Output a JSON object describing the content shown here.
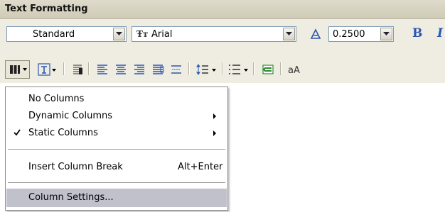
{
  "panel": {
    "title": "Text Formatting"
  },
  "row1": {
    "style_value": "Standard",
    "font_value": "Arial",
    "height_value": "0.2500",
    "bold_label": "B",
    "italic_label": "I"
  },
  "row2": {
    "case_label": "aA"
  },
  "menu": {
    "items": [
      {
        "label": "No Columns"
      },
      {
        "label": "Dynamic Columns"
      },
      {
        "label": "Static Columns"
      },
      {
        "label": "Insert Column Break",
        "shortcut": "Alt+Enter"
      },
      {
        "label": "Column Settings..."
      }
    ]
  },
  "colors": {
    "panel_bg": "#efede2",
    "title_bar": "#d6d2c0",
    "field_border": "#7f9db9",
    "highlight": "#c1c1cc",
    "accent_blue": "#2b56b0",
    "green_icon": "#2e8b2e"
  },
  "icons": [
    "columns-icon",
    "justify-icon",
    "paragraph-icon",
    "align-left-icon",
    "align-center-icon",
    "align-right-icon",
    "align-justify-icon",
    "distribute-icon",
    "line-spacing-icon",
    "numbering-icon",
    "insert-field-icon",
    "checkmark-icon",
    "submenu-arrow-icon"
  ]
}
